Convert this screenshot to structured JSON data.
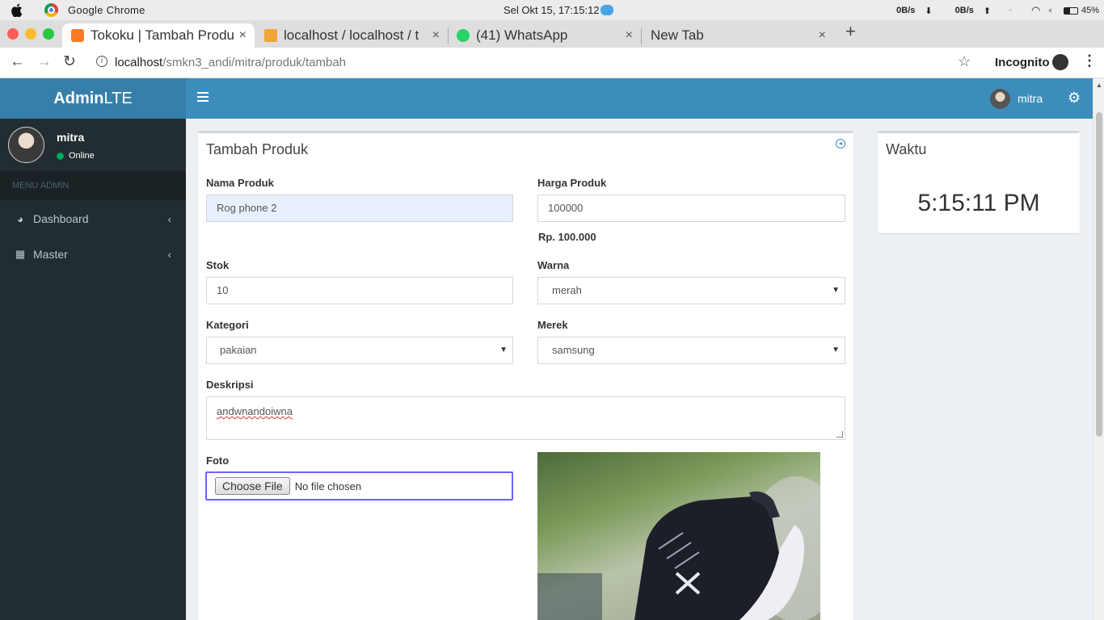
{
  "macos": {
    "app_name": "Google Chrome",
    "clock": "Sel Okt 15, 17:15:12",
    "net_down": "0B/s",
    "net_up": "0B/s",
    "battery": "45%"
  },
  "browser": {
    "tabs": [
      {
        "title": "Tokoku | Tambah Produk",
        "close": "×",
        "active": true
      },
      {
        "title": "localhost / localhost / t",
        "close": "×",
        "active": false
      },
      {
        "title": "(41) WhatsApp",
        "close": "×",
        "active": false
      },
      {
        "title": "New Tab",
        "close": "×",
        "active": false
      }
    ],
    "new_tab": "+",
    "url_host": "localhost",
    "url_path": "/smkn3_andi/mitra/produk/tambah",
    "incognito_label": "Incognito"
  },
  "app": {
    "logo_bold": "Admin",
    "logo_rest": "LTE",
    "user_name": "mitra"
  },
  "sidebar": {
    "user_name": "mitra",
    "status": "Online",
    "header": "MENU ADMIN",
    "items": [
      {
        "label": "Dashboard"
      },
      {
        "label": "Master"
      }
    ]
  },
  "form": {
    "title": "Tambah Produk",
    "nama_label": "Nama Produk",
    "nama_value": "Rog phone 2",
    "harga_label": "Harga Produk",
    "harga_value": "100000",
    "harga_formatted": "Rp. 100.000",
    "stok_label": "Stok",
    "stok_value": "10",
    "warna_label": "Warna",
    "warna_value": "merah",
    "kategori_label": "Kategori",
    "kategori_value": "pakaian",
    "merek_label": "Merek",
    "merek_value": "samsung",
    "deskripsi_label": "Deskripsi",
    "deskripsi_value": "andwnandoiwna",
    "foto_label": "Foto",
    "file_button": "Choose File",
    "file_status": "No file chosen"
  },
  "waktu": {
    "title": "Waktu",
    "time": "5:15:11 PM"
  },
  "colors": {
    "header_blue": "#3c8dbc",
    "logo_blue": "#367fa9",
    "sidebar_dark": "#222d32",
    "online_green": "#00a65a",
    "content_bg": "#ecf0f5"
  }
}
